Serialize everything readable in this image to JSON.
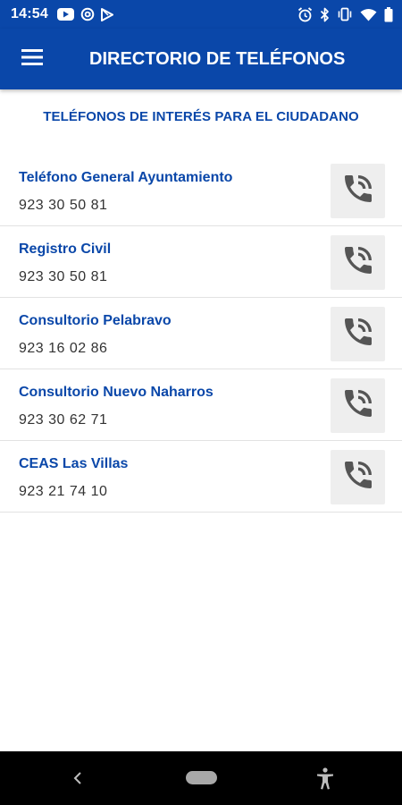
{
  "status_bar": {
    "time": "14:54",
    "left_icons": [
      "youtube-icon",
      "at-icon",
      "play-store-icon"
    ],
    "right_icons": [
      "alarm-icon",
      "bluetooth-icon",
      "vibrate-icon",
      "wifi-icon",
      "battery-icon"
    ]
  },
  "app_bar": {
    "title": "DIRECTORIO DE TELÉFONOS",
    "menu_icon": "hamburger-menu-icon"
  },
  "section": {
    "heading": "TELÉFONOS DE INTERÉS PARA EL CIUDADANO"
  },
  "contacts": [
    {
      "name": "Teléfono General Ayuntamiento",
      "number": "923 30 50 81"
    },
    {
      "name": "Registro Civil",
      "number": "923 30 50 81"
    },
    {
      "name": "Consultorio Pelabravo",
      "number": "923 16 02 86"
    },
    {
      "name": "Consultorio Nuevo Naharros",
      "number": "923 30 62 71"
    },
    {
      "name": "CEAS Las Villas",
      "number": "923 21 74 10"
    }
  ],
  "call_icon": "phone-ringing-icon",
  "colors": {
    "primary": "#0a47a9",
    "call_button_bg": "#eeeeee",
    "icon_gray": "#555555",
    "divider": "#e2e2e2",
    "nav_bar": "#000000"
  },
  "nav_bar": {
    "icons": [
      "back-icon",
      "home-pill",
      "accessibility-icon"
    ]
  }
}
